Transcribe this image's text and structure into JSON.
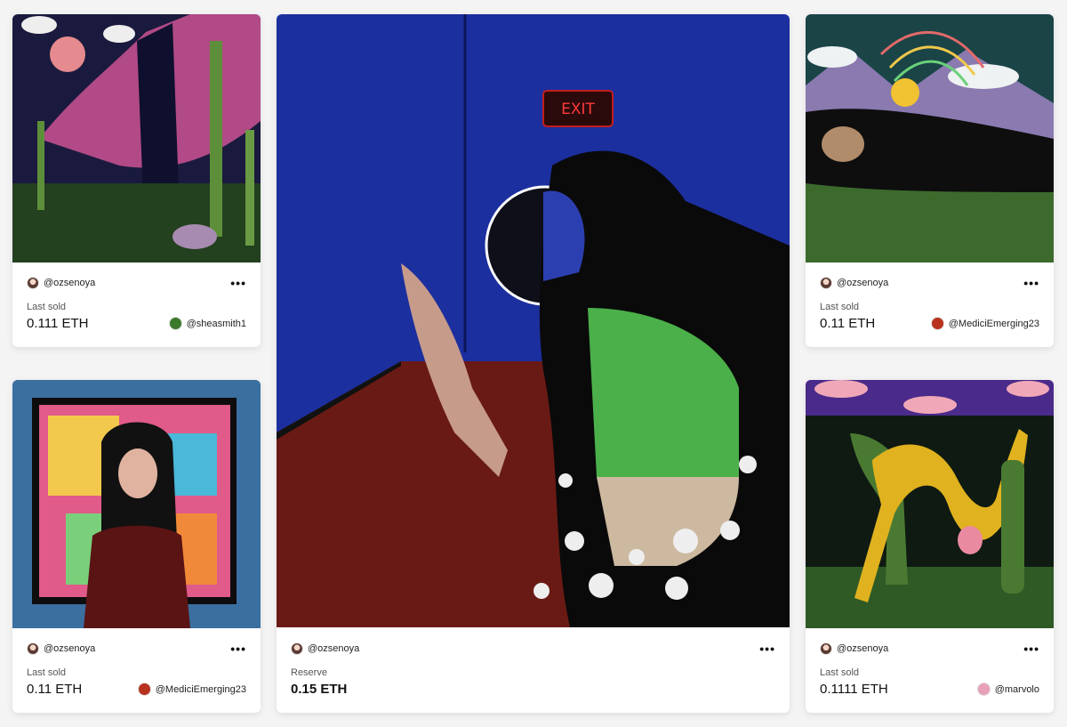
{
  "cards": [
    {
      "art_name": "cactus-night-mountain-artwork",
      "creator": "@ozsenoya",
      "label": "Last sold",
      "price": "0.111 ETH",
      "buyer": "@sheasmith1",
      "buyer_color": "#3a7a2a"
    },
    {
      "art_name": "exit-woman-eyes-artwork",
      "creator": "@ozsenoya",
      "label": "Reserve",
      "price": "0.15 ETH",
      "exit_sign": "EXIT"
    },
    {
      "art_name": "rainbow-woman-meadow-artwork",
      "creator": "@ozsenoya",
      "label": "Last sold",
      "price": "0.11 ETH",
      "buyer": "@MediciEmerging23",
      "buyer_color": "#b8321e"
    },
    {
      "art_name": "portrait-colorful-frame-artwork",
      "creator": "@ozsenoya",
      "label": "Last sold",
      "price": "0.11 ETH",
      "buyer": "@MediciEmerging23",
      "buyer_color": "#b8321e"
    },
    {
      "art_name": "yellow-figure-cactus-artwork",
      "creator": "@ozsenoya",
      "label": "Last sold",
      "price": "0.1111 ETH",
      "buyer": "@marvolo",
      "buyer_color": "#e8a0b8"
    }
  ],
  "more_icon": "more-horizontal-icon"
}
